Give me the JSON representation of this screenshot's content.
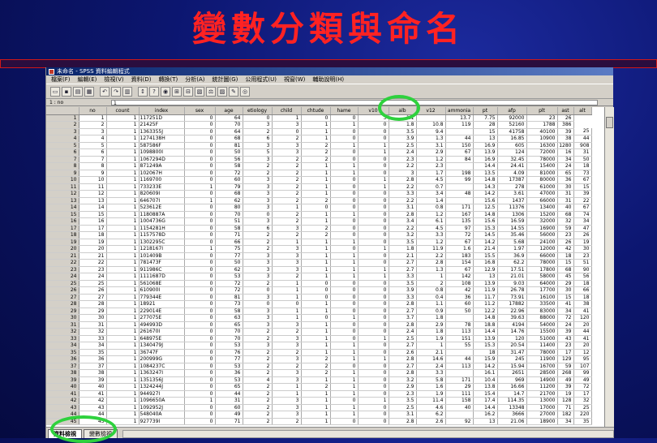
{
  "slide_title": "變數分類與命名",
  "window": {
    "title": "未命名 - SPSS 資料編輯程式",
    "menu": [
      "檔案(F)",
      "編輯(E)",
      "檢視(V)",
      "資料(D)",
      "轉換(T)",
      "分析(A)",
      "統計圖(G)",
      "公用程式(U)",
      "視窗(W)",
      "輔助說明(H)"
    ],
    "cell_address": "1 : no",
    "cell_value": "1"
  },
  "columns": [
    "no",
    "count",
    "index",
    "sex",
    "age",
    "etiology",
    "child",
    "chtude",
    "hame",
    "v10",
    "alb",
    "v12",
    "ammonia",
    "pt",
    "afp",
    "plt",
    "ast",
    "alt"
  ],
  "rows": [
    [
      "1",
      "1",
      "1",
      "117251D",
      "0",
      "64",
      "0",
      "1",
      "0",
      "0",
      "3",
      "1.1",
      "",
      "13.7",
      "7.75",
      "92000",
      "23",
      "26"
    ],
    [
      "2",
      "2",
      "1",
      "21425F",
      "0",
      "70",
      "3",
      "3",
      "1",
      "1",
      "0",
      "1.8",
      "10.8",
      "119",
      "28",
      "52160",
      "1788",
      "386"
    ],
    [
      "3",
      "3",
      "1",
      "1363355J",
      "0",
      "64",
      "2",
      "0",
      "1",
      "0",
      "0",
      "3.5",
      "9.4",
      "",
      "15",
      "41758",
      "40100",
      "39",
      "25"
    ],
    [
      "4",
      "4",
      "1",
      "1274138H",
      "0",
      "68",
      "6",
      "2",
      "1",
      "0",
      "0",
      "3.9",
      "1.3",
      "44",
      "13",
      "16.85",
      "10900",
      "38",
      "44"
    ],
    [
      "5",
      "5",
      "1",
      "587586F",
      "0",
      "81",
      "3",
      "3",
      "2",
      "1",
      "1",
      "2.5",
      "3.1",
      "150",
      "16.9",
      "605",
      "16300",
      "1280",
      "908"
    ],
    [
      "6",
      "6",
      "1",
      "1098800I",
      "0",
      "50",
      "5",
      "3",
      "2",
      "0",
      "1",
      "2.4",
      "2.9",
      "67",
      "13.9",
      "124",
      "72000",
      "16",
      "31"
    ],
    [
      "7",
      "7",
      "1",
      "1067294D",
      "0",
      "56",
      "3",
      "2",
      "2",
      "0",
      "0",
      "2.3",
      "1.2",
      "84",
      "16.9",
      "32.45",
      "78000",
      "34",
      "50"
    ],
    [
      "8",
      "8",
      "1",
      "871249A",
      "0",
      "58",
      "2",
      "2",
      "1",
      "1",
      "0",
      "2.2",
      "2.3",
      "",
      "14.4",
      "24.41",
      "15400",
      "24",
      "18"
    ],
    [
      "9",
      "9",
      "1",
      "102067H",
      "0",
      "72",
      "2",
      "2",
      "1",
      "1",
      "0",
      "3",
      "1.7",
      "198",
      "13.5",
      "4.09",
      "81000",
      "65",
      "73"
    ],
    [
      "10",
      "10",
      "1",
      "1169700",
      "0",
      "60",
      "3",
      "2",
      "1",
      "0",
      "1",
      "2.8",
      "4.5",
      "99",
      "14.8",
      "17387",
      "80000",
      "36",
      "67"
    ],
    [
      "11",
      "11",
      "1",
      "733233E",
      "1",
      "79",
      "3",
      "2",
      "1",
      "0",
      "1",
      "2.2",
      "0.7",
      "",
      "14.3",
      "278",
      "61000",
      "30",
      "15"
    ],
    [
      "12",
      "12",
      "1",
      "820609I",
      "0",
      "68",
      "3",
      "2",
      "1",
      "0",
      "0",
      "3.3",
      "3.4",
      "48",
      "14.2",
      "3.61",
      "47000",
      "31",
      "39"
    ],
    [
      "13",
      "13",
      "1",
      "646707I",
      "1",
      "62",
      "3",
      "2",
      "2",
      "0",
      "0",
      "2.2",
      "1.4",
      "",
      "15.6",
      "1437",
      "66000",
      "31",
      "22"
    ],
    [
      "14",
      "14",
      "1",
      "523612E",
      "0",
      "80",
      "3",
      "1",
      "0",
      "0",
      "0",
      "3.1",
      "0.8",
      "171",
      "12.5",
      "11376",
      "13400",
      "40",
      "67"
    ],
    [
      "15",
      "15",
      "1",
      "1180887A",
      "0",
      "70",
      "0",
      "2",
      "1",
      "1",
      "0",
      "2.8",
      "1.2",
      "167",
      "14.8",
      "1306",
      "15200",
      "68",
      "74"
    ],
    [
      "16",
      "16",
      "1",
      "1004736G",
      "0",
      "51",
      "3",
      "2",
      "1",
      "0",
      "0",
      "3.4",
      "6.1",
      "135",
      "15.6",
      "16.59",
      "32000",
      "32",
      "34"
    ],
    [
      "17",
      "17",
      "1",
      "1154281H",
      "0",
      "58",
      "6",
      "3",
      "2",
      "0",
      "0",
      "2.2",
      "4.5",
      "97",
      "15.3",
      "14.55",
      "16900",
      "59",
      "47"
    ],
    [
      "18",
      "18",
      "1",
      "1157578D",
      "0",
      "71",
      "2",
      "2",
      "2",
      "0",
      "0",
      "3.2",
      "3.3",
      "72",
      "14.5",
      "35.46",
      "56000",
      "23",
      "26"
    ],
    [
      "19",
      "19",
      "1",
      "1302295C",
      "0",
      "66",
      "2",
      "1",
      "1",
      "1",
      "0",
      "3.5",
      "1.2",
      "67",
      "14.2",
      "5.68",
      "24100",
      "26",
      "19"
    ],
    [
      "20",
      "20",
      "1",
      "1218167I",
      "1",
      "75",
      "2",
      "3",
      "1",
      "0",
      "1",
      "1.8",
      "11.9",
      "1.6",
      "21.4",
      "1.97",
      "12000",
      "42",
      "30"
    ],
    [
      "21",
      "21",
      "1",
      "101409B",
      "0",
      "77",
      "3",
      "3",
      "1",
      "1",
      "0",
      "2.1",
      "2.2",
      "183",
      "15.5",
      "36.9",
      "66000",
      "18",
      "23"
    ],
    [
      "22",
      "22",
      "1",
      "781473F",
      "0",
      "50",
      "3",
      "3",
      "1",
      "1",
      "0",
      "2.7",
      "2.8",
      "154",
      "16.8",
      "62.2",
      "78000",
      "15",
      "51"
    ],
    [
      "23",
      "23",
      "1",
      "911986C",
      "0",
      "62",
      "3",
      "3",
      "1",
      "1",
      "1",
      "2.7",
      "1.3",
      "67",
      "12.9",
      "17.51",
      "17800",
      "68",
      "90"
    ],
    [
      "24",
      "24",
      "1",
      "1111687D",
      "0",
      "53",
      "3",
      "2",
      "1",
      "1",
      "1",
      "3.3",
      "1",
      "142",
      "13",
      "21.01",
      "58000",
      "45",
      "56"
    ],
    [
      "25",
      "25",
      "1",
      "561068E",
      "0",
      "72",
      "2",
      "1",
      "0",
      "0",
      "0",
      "3.5",
      "2",
      "108",
      "13.9",
      "9.03",
      "64000",
      "29",
      "18"
    ],
    [
      "26",
      "26",
      "1",
      "610900I",
      "0",
      "72",
      "0",
      "1",
      "0",
      "0",
      "0",
      "3.9",
      "0.8",
      "42",
      "11.9",
      "26.78",
      "17700",
      "30",
      "66"
    ],
    [
      "27",
      "27",
      "1",
      "779344E",
      "0",
      "81",
      "3",
      "1",
      "0",
      "0",
      "0",
      "3.3",
      "0.4",
      "36",
      "11.7",
      "73.91",
      "16100",
      "15",
      "18"
    ],
    [
      "28",
      "28",
      "1",
      "18921",
      "0",
      "73",
      "0",
      "0",
      "1",
      "0",
      "0",
      "2.8",
      "1.1",
      "60",
      "11.2",
      "17882",
      "33500",
      "41",
      "38"
    ],
    [
      "29",
      "29",
      "1",
      "229014E",
      "0",
      "58",
      "3",
      "1",
      "1",
      "0",
      "0",
      "2.7",
      "0.9",
      "50",
      "12.2",
      "22.96",
      "83000",
      "34",
      "41"
    ],
    [
      "30",
      "30",
      "1",
      "277075E",
      "0",
      "63",
      "3",
      "1",
      "0",
      "1",
      "0",
      "3.7",
      "1.8",
      "",
      "14.8",
      "39.63",
      "88000",
      "72",
      "120"
    ],
    [
      "31",
      "31",
      "1",
      "494993D",
      "0",
      "65",
      "3",
      "3",
      "1",
      "0",
      "0",
      "2.8",
      "2.9",
      "78",
      "18.8",
      "4194",
      "54000",
      "24",
      "20"
    ],
    [
      "32",
      "32",
      "1",
      "261670I",
      "0",
      "70",
      "2",
      "2",
      "1",
      "0",
      "0",
      "2.4",
      "1.8",
      "113",
      "14.4",
      "14.76",
      "15500",
      "39",
      "44"
    ],
    [
      "33",
      "33",
      "1",
      "648975E",
      "0",
      "70",
      "2",
      "3",
      "1",
      "0",
      "1",
      "2.5",
      "1.9",
      "151",
      "13.9",
      "120",
      "51000",
      "43",
      "41"
    ],
    [
      "34",
      "34",
      "1",
      "1340479J",
      "0",
      "53",
      "3",
      "3",
      "1",
      "1",
      "0",
      "2.7",
      "1",
      "55",
      "15.3",
      "20.54",
      "11400",
      "23",
      "20"
    ],
    [
      "35",
      "35",
      "1",
      "36747F",
      "0",
      "76",
      "2",
      "2",
      "1",
      "1",
      "0",
      "2.6",
      "2.1",
      "",
      "18",
      "31.47",
      "78000",
      "17",
      "12"
    ],
    [
      "36",
      "36",
      "1",
      "200999G",
      "0",
      "77",
      "2",
      "3",
      "2",
      "1",
      "1",
      "2.8",
      "14.6",
      "44",
      "15.9",
      "245",
      "11900",
      "129",
      "95"
    ],
    [
      "37",
      "37",
      "1",
      "1084237C",
      "0",
      "53",
      "2",
      "2",
      "2",
      "0",
      "0",
      "2.7",
      "2.4",
      "113",
      "14.2",
      "15.94",
      "16700",
      "59",
      "107"
    ],
    [
      "38",
      "38",
      "1",
      "1363247I",
      "0",
      "36",
      "2",
      "3",
      "2",
      "1",
      "0",
      "2.8",
      "3.3",
      "",
      "16.1",
      "2651",
      "28500",
      "268",
      "99"
    ],
    [
      "39",
      "39",
      "1",
      "1351356J",
      "0",
      "53",
      "4",
      "3",
      "1",
      "1",
      "0",
      "3.2",
      "5.8",
      "171",
      "10.4",
      "969",
      "14900",
      "49",
      "49"
    ],
    [
      "40",
      "40",
      "1",
      "1324244J",
      "0",
      "65",
      "2",
      "1",
      "2",
      "1",
      "0",
      "2.9",
      "1.6",
      "29",
      "13.8",
      "16.66",
      "11200",
      "39",
      "72"
    ],
    [
      "41",
      "41",
      "1",
      "944927I",
      "0",
      "44",
      "2",
      "1",
      "1",
      "1",
      "0",
      "2.3",
      "1.9",
      "111",
      "15.4",
      "14.7",
      "21700",
      "19",
      "17"
    ],
    [
      "42",
      "42",
      "1",
      "1096650A",
      "1",
      "31",
      "2",
      "3",
      "1",
      "0",
      "1",
      "3.5",
      "11.4",
      "158",
      "17.4",
      "114.35",
      "13000",
      "128",
      "32"
    ],
    [
      "43",
      "43",
      "1",
      "1092952J",
      "0",
      "60",
      "2",
      "3",
      "1",
      "1",
      "0",
      "2.5",
      "4.6",
      "40",
      "14.4",
      "13348",
      "17000",
      "71",
      "25"
    ],
    [
      "44",
      "44",
      "1",
      "548040A",
      "0",
      "49",
      "2",
      "3",
      "1",
      "1",
      "0",
      "3.1",
      "6.2",
      "",
      "16.2",
      "3666",
      "27000",
      "182",
      "220"
    ],
    [
      "45",
      "45",
      "1",
      "927739I",
      "0",
      "71",
      "2",
      "2",
      "1",
      "0",
      "0",
      "2.8",
      "2.6",
      "92",
      "13",
      "21.06",
      "18900",
      "34",
      "35"
    ]
  ],
  "tabs": {
    "data_view": "資料檢視",
    "variable_view": "變數檢視"
  },
  "highlight_color": "#2ed13d",
  "title_color": "#ff2222"
}
